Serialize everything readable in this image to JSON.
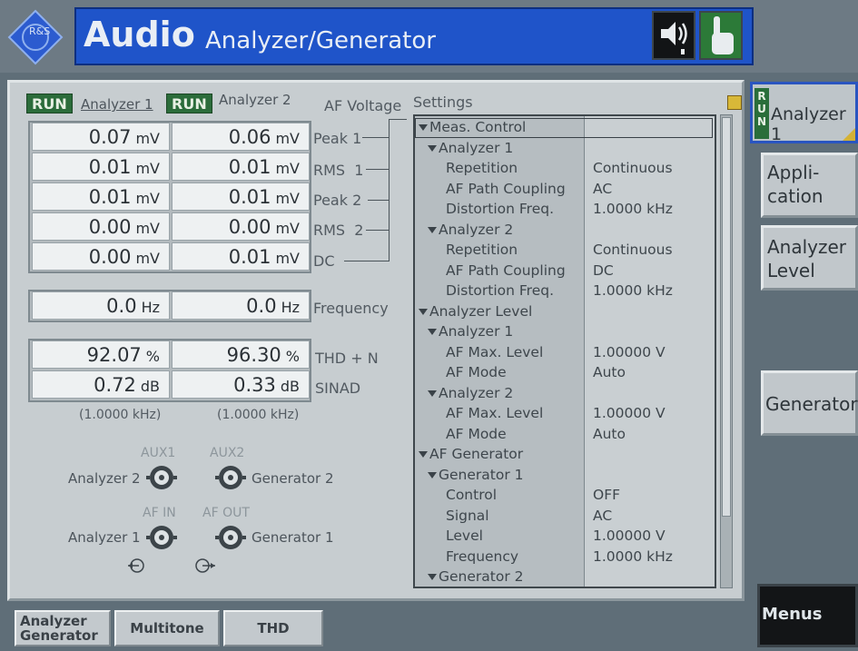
{
  "header": {
    "title_main": "Audio",
    "title_sub": "Analyzer/Generator",
    "logo_letters": "R&S"
  },
  "analyzers": {
    "run_badge": "RUN",
    "analyzer1_label": "Analyzer 1",
    "analyzer2_label": "Analyzer 2",
    "af_voltage_label": "AF Voltage"
  },
  "measurements": [
    {
      "label": "Peak 1",
      "a1": "0.07",
      "u1": "mV",
      "a2": "0.06",
      "u2": "mV"
    },
    {
      "label": "RMS  1",
      "a1": "0.01",
      "u1": "mV",
      "a2": "0.01",
      "u2": "mV"
    },
    {
      "label": "Peak 2",
      "a1": "0.01",
      "u1": "mV",
      "a2": "0.01",
      "u2": "mV"
    },
    {
      "label": "RMS  2",
      "a1": "0.00",
      "u1": "mV",
      "a2": "0.00",
      "u2": "mV"
    },
    {
      "label": "DC",
      "a1": "0.00",
      "u1": "mV",
      "a2": "0.01",
      "u2": "mV"
    }
  ],
  "frequency": {
    "label": "Frequency",
    "a1": "0.0",
    "u1": "Hz",
    "a2": "0.0",
    "u2": "Hz"
  },
  "thd": {
    "label": "THD + N",
    "a1": "92.07",
    "u1": "%",
    "a2": "96.30",
    "u2": "%"
  },
  "sinad": {
    "label": "SINAD",
    "a1": "0.72",
    "u1": "dB",
    "a2": "0.33",
    "u2": "dB"
  },
  "distortion_freq": {
    "a1": "(1.0000  kHz)",
    "a2": "(1.0000  kHz)"
  },
  "connectors": {
    "aux1": "AUX1",
    "aux2": "AUX2",
    "af_in": "AF IN",
    "af_out": "AF OUT",
    "analyzer2": "Analyzer 2",
    "generator2": "Generator 2",
    "analyzer1": "Analyzer 1",
    "generator1": "Generator 1"
  },
  "settings": {
    "title": "Settings",
    "rows": [
      {
        "level": 0,
        "label": "Meas. Control",
        "value": "",
        "expandable": true
      },
      {
        "level": 1,
        "label": "Analyzer 1",
        "value": "",
        "expandable": true
      },
      {
        "level": 2,
        "label": "Repetition",
        "value": "Continuous",
        "expandable": false
      },
      {
        "level": 2,
        "label": "AF Path Coupling",
        "value": "AC",
        "expandable": false
      },
      {
        "level": 2,
        "label": "Distortion Freq.",
        "value": "1.0000  kHz",
        "expandable": false
      },
      {
        "level": 1,
        "label": "Analyzer 2",
        "value": "",
        "expandable": true
      },
      {
        "level": 2,
        "label": "Repetition",
        "value": "Continuous",
        "expandable": false
      },
      {
        "level": 2,
        "label": "AF Path Coupling",
        "value": "DC",
        "expandable": false
      },
      {
        "level": 2,
        "label": "Distortion Freq.",
        "value": "1.0000  kHz",
        "expandable": false
      },
      {
        "level": 0,
        "label": "Analyzer Level",
        "value": "",
        "expandable": true
      },
      {
        "level": 1,
        "label": "Analyzer 1",
        "value": "",
        "expandable": true
      },
      {
        "level": 2,
        "label": "AF Max. Level",
        "value": "1.00000  V",
        "expandable": false
      },
      {
        "level": 2,
        "label": "AF Mode",
        "value": "Auto",
        "expandable": false
      },
      {
        "level": 1,
        "label": "Analyzer 2",
        "value": "",
        "expandable": true
      },
      {
        "level": 2,
        "label": "AF Max. Level",
        "value": "1.00000  V",
        "expandable": false
      },
      {
        "level": 2,
        "label": "AF Mode",
        "value": "Auto",
        "expandable": false
      },
      {
        "level": 0,
        "label": "AF Generator",
        "value": "",
        "expandable": true
      },
      {
        "level": 1,
        "label": "Generator 1",
        "value": "",
        "expandable": true
      },
      {
        "level": 2,
        "label": "Control",
        "value": "OFF",
        "expandable": false
      },
      {
        "level": 2,
        "label": "Signal",
        "value": "AC",
        "expandable": false
      },
      {
        "level": 2,
        "label": "Level",
        "value": "1.00000  V",
        "expandable": false
      },
      {
        "level": 2,
        "label": "Frequency",
        "value": "1.0000  kHz",
        "expandable": false
      },
      {
        "level": 1,
        "label": "Generator 2",
        "value": "",
        "expandable": true
      }
    ]
  },
  "softkeys": {
    "analyzer1": "Analyzer 1",
    "run_vertical": "R U N",
    "application": "Appli-\ncation",
    "analyzer_level": "Analyzer\nLevel",
    "generator": "Generator",
    "menus": "Menus"
  },
  "tabs": {
    "analyzer_generator": "Analyzer\nGenerator",
    "multitone": "Multitone",
    "thd": "THD"
  },
  "colors": {
    "title_blue": "#1f54c9",
    "run_green": "#2b6c3a",
    "panel_gray": "#c7cdd0"
  }
}
